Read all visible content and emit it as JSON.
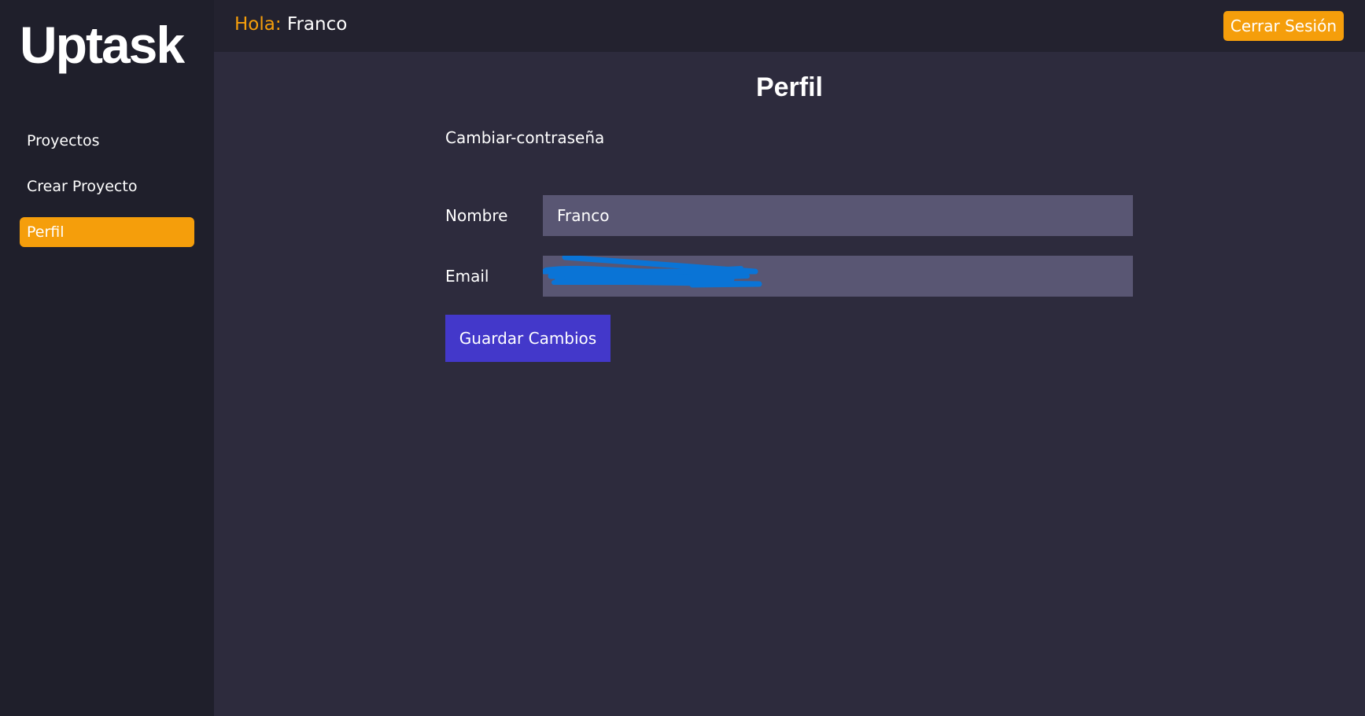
{
  "sidebar": {
    "brand": "Uptask",
    "items": [
      {
        "label": "Proyectos",
        "active": false
      },
      {
        "label": "Crear Proyecto",
        "active": false
      },
      {
        "label": "Perfil",
        "active": true
      }
    ]
  },
  "header": {
    "greeting_prefix": "Hola:",
    "user_name": "Franco",
    "logout_label": "Cerrar Sesión"
  },
  "main": {
    "title": "Perfil",
    "change_password_link": "Cambiar-contraseña",
    "form": {
      "name_label": "Nombre",
      "name_value": "Franco",
      "email_label": "Email",
      "email_value": "",
      "submit_label": "Guardar Cambios"
    }
  },
  "colors": {
    "accent": "#f59e0b",
    "primary_button": "#4338ca",
    "input_bg": "#595673",
    "main_bg": "#2d2b3d",
    "sidebar_bg": "#1f1f2b",
    "redaction": "#0a74d6"
  }
}
